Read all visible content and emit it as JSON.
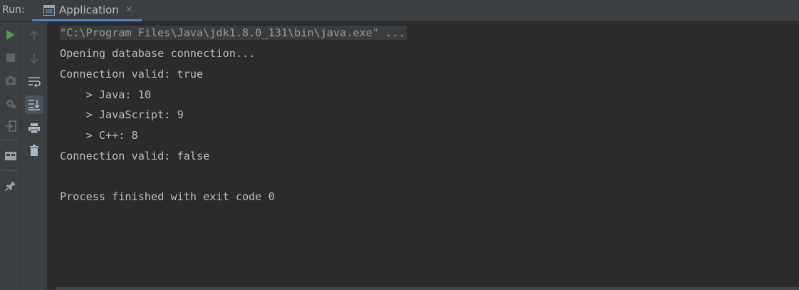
{
  "run_panel": {
    "label": "Run:",
    "tab": {
      "title": "Application",
      "close_glyph": "×"
    }
  },
  "left_toolbar": [
    "run-icon",
    "stop-icon",
    "camera-icon",
    "debug-settings-icon",
    "exit-icon",
    "layout-icon",
    "pin-icon"
  ],
  "right_toolbar": [
    "up-arrow-icon",
    "down-arrow-icon",
    "soft-wrap-icon",
    "scroll-to-end-icon",
    "print-icon",
    "trash-icon"
  ],
  "console": {
    "lines": [
      "\"C:\\Program Files\\Java\\jdk1.8.0_131\\bin\\java.exe\" ...",
      "Opening database connection...",
      "Connection valid: true",
      "    > Java: 10",
      "    > JavaScript: 9",
      "    > C++: 8",
      "Connection valid: false",
      "",
      "Process finished with exit code 0"
    ]
  },
  "colors": {
    "accent": "#4a88c7",
    "run_green": "#499c54",
    "background": "#2b2b2b",
    "panel": "#3c3f41"
  }
}
